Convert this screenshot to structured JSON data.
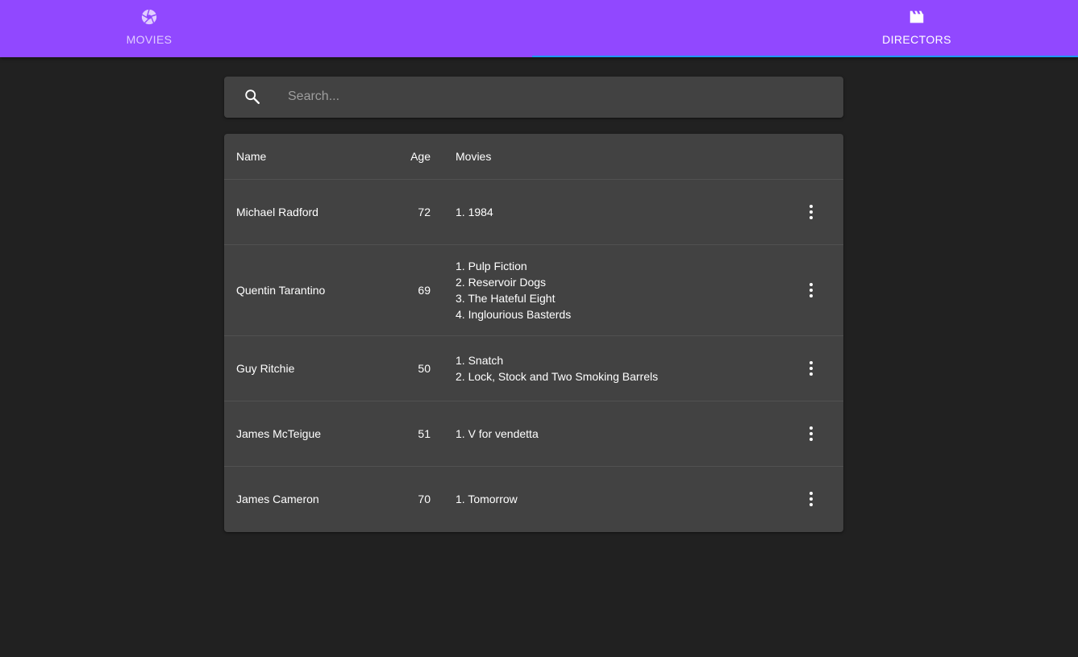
{
  "tabs": [
    {
      "label": "MOVIES",
      "icon": "camera-aperture-icon"
    },
    {
      "label": "DIRECTORS",
      "icon": "clapperboard-icon"
    }
  ],
  "colors": {
    "appbar": "#9148ff",
    "indicator": "#2196f3",
    "background": "#212121",
    "paper": "#424242"
  },
  "search": {
    "placeholder": "Search..."
  },
  "table": {
    "headers": {
      "name": "Name",
      "age": "Age",
      "movies": "Movies"
    },
    "rows": [
      {
        "name": "Michael Radford",
        "age": "72",
        "movies": [
          "1. 1984"
        ]
      },
      {
        "name": "Quentin Tarantino",
        "age": "69",
        "movies": [
          "1. Pulp Fiction",
          "2. Reservoir Dogs",
          "3. The Hateful Eight",
          "4. Inglourious Basterds"
        ]
      },
      {
        "name": "Guy Ritchie",
        "age": "50",
        "movies": [
          "1. Snatch",
          "2. Lock, Stock and Two Smoking Barrels"
        ]
      },
      {
        "name": "James McTeigue",
        "age": "51",
        "movies": [
          "1. V for vendetta"
        ]
      },
      {
        "name": "James Cameron",
        "age": "70",
        "movies": [
          "1. Tomorrow"
        ]
      }
    ],
    "row_action_icon": "more-vert-icon"
  }
}
